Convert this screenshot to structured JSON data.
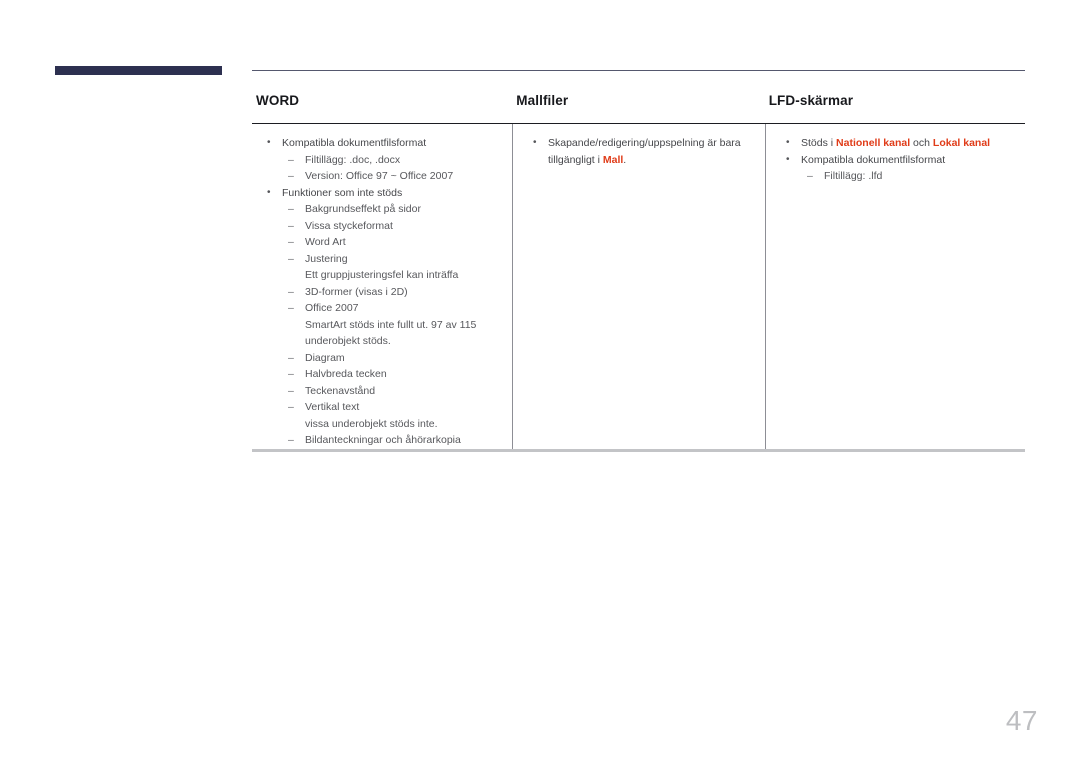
{
  "page": {
    "number": "47"
  },
  "table": {
    "headers": [
      {
        "label": "WORD"
      },
      {
        "label": "Mallfiler"
      },
      {
        "label": "LFD-skärmar"
      }
    ],
    "columns": [
      {
        "items": [
          {
            "level": 1,
            "marker": "•",
            "text": "Kompatibla dokumentfilsformat"
          },
          {
            "level": 2,
            "marker": "–",
            "text": "Filtillägg: .doc, .docx"
          },
          {
            "level": 2,
            "marker": "–",
            "text": "Version: Office 97 ~ Office 2007"
          },
          {
            "level": 1,
            "marker": "•",
            "text": "Funktioner som inte stöds"
          },
          {
            "level": 2,
            "marker": "–",
            "text": "Bakgrundseffekt på sidor"
          },
          {
            "level": 2,
            "marker": "–",
            "text": "Vissa styckeformat"
          },
          {
            "level": 2,
            "marker": "–",
            "text": "Word Art"
          },
          {
            "level": 2,
            "marker": "–",
            "text": "Justering"
          },
          {
            "level": 0,
            "marker": "",
            "text": "Ett gruppjusteringsfel kan inträffa"
          },
          {
            "level": 2,
            "marker": "–",
            "text": "3D-former (visas i 2D)"
          },
          {
            "level": 2,
            "marker": "–",
            "text": "Office 2007"
          },
          {
            "level": 0,
            "marker": "",
            "text": "SmartArt stöds inte fullt ut. 97 av 115 underobjekt stöds."
          },
          {
            "level": 2,
            "marker": "–",
            "text": "Diagram"
          },
          {
            "level": 2,
            "marker": "–",
            "text": "Halvbreda tecken"
          },
          {
            "level": 2,
            "marker": "–",
            "text": "Teckenavstånd"
          },
          {
            "level": 2,
            "marker": "–",
            "text": "Vertikal text"
          },
          {
            "level": 0,
            "marker": "",
            "text": "vissa underobjekt stöds inte."
          },
          {
            "level": 2,
            "marker": "–",
            "text": "Bildanteckningar och åhörarkopia"
          }
        ]
      },
      {
        "items": [
          {
            "level": 1,
            "marker": "•",
            "text": "Skapande/redigering/uppspelning är bara tillgängligt i Mall.",
            "parts": [
              {
                "t": "Skapande/redigering/uppspelning är bara tillgängligt i ",
                "accent": false
              },
              {
                "t": "Mall",
                "accent": true
              },
              {
                "t": ".",
                "accent": false
              }
            ]
          }
        ]
      },
      {
        "items": [
          {
            "level": 1,
            "marker": "•",
            "text": "Stöds i Nationell kanal och Lokal kanal",
            "parts": [
              {
                "t": "Stöds i ",
                "accent": false
              },
              {
                "t": "Nationell kanal",
                "accent": true
              },
              {
                "t": " och ",
                "accent": false
              },
              {
                "t": "Lokal kanal",
                "accent": true
              }
            ]
          },
          {
            "level": 1,
            "marker": "•",
            "text": "Kompatibla dokumentfilsformat"
          },
          {
            "level": 2,
            "marker": "–",
            "text": "Filtillägg: .lfd"
          }
        ]
      }
    ]
  },
  "colors": {
    "deco_bar": "#2d3050",
    "accent": "#e03c19",
    "page_number": "#bdbec1"
  }
}
